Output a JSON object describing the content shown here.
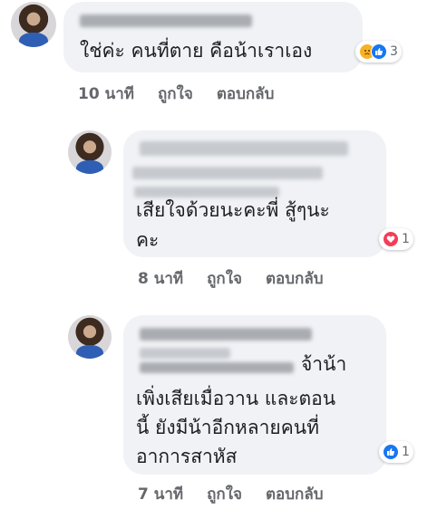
{
  "comments": [
    {
      "text_lines": [
        "ใช่ค่ะ คนที่ตาย คือน้าเราเอง"
      ],
      "reaction_count": "3",
      "reaction_icons": [
        "sad-icon",
        "like-icon"
      ],
      "time": "10 นาที",
      "like_label": "ถูกใจ",
      "reply_label": "ตอบกลับ"
    },
    {
      "text_lines": [
        "เสียใจด้วยนะคะพี่ สู้ๆนะ",
        "คะ"
      ],
      "reaction_count": "1",
      "reaction_icons": [
        "love-icon"
      ],
      "time": "8 นาที",
      "like_label": "ถูกใจ",
      "reply_label": "ตอบกลับ"
    },
    {
      "text_lines": [
        "จ้าน้า",
        "เพิ่งเสียเมื่อวาน และตอน",
        "นี้ ยังมีน้าอีกหลายคนที่",
        "อาการสาหัส"
      ],
      "reaction_count": "1",
      "reaction_icons": [
        "like-icon"
      ],
      "time": "7 นาที",
      "like_label": "ถูกใจ",
      "reply_label": "ตอบกลับ"
    }
  ],
  "colors": {
    "bubble": "#f0f2f5",
    "meta_text": "#65676b",
    "like_blue": "#1877f2",
    "love_red": "#f33e58",
    "sad_yellow": "#f7b125"
  }
}
